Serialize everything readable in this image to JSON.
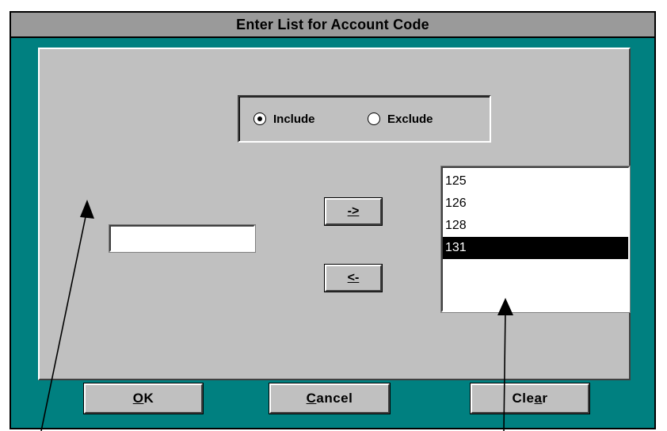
{
  "window": {
    "title": "Enter List for Account Code"
  },
  "mode": {
    "include_label": "Include",
    "exclude_label": "Exclude",
    "selected": "Include"
  },
  "entry": {
    "value": ""
  },
  "transfer": {
    "add_label": "->",
    "remove_label": "<-"
  },
  "list": {
    "items": [
      "125",
      "126",
      "128",
      "131"
    ],
    "selected_item": "131"
  },
  "buttons": {
    "ok_label": "OK",
    "ok_mnemonic": "O",
    "ok_rest": "K",
    "cancel_mnemonic": "C",
    "cancel_rest": "ancel",
    "clear_prefix": "Cle",
    "clear_mnemonic": "a",
    "clear_rest": "r"
  },
  "colors": {
    "frame": "#008080",
    "panel": "#c0c0c0",
    "titlebar": "#9a9a9a",
    "selection": "#000000"
  },
  "icons": [
    "radio-checked-icon",
    "radio-unchecked-icon",
    "callout-arrow-icon"
  ]
}
